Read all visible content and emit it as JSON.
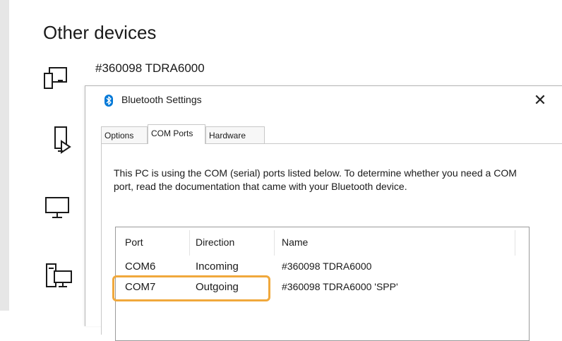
{
  "page": {
    "title": "Other devices"
  },
  "devices": [
    {
      "name": "#360098 TDRA6000",
      "icon": "phone-device-icon"
    },
    {
      "icon": "mobile-cast-device-icon"
    },
    {
      "icon": "monitor-icon"
    },
    {
      "icon": "computer-tower-icon"
    }
  ],
  "dialog": {
    "title": "Bluetooth Settings",
    "close_label": "✕",
    "tabs": [
      {
        "label": "Options",
        "active": false
      },
      {
        "label": "COM Ports",
        "active": true
      },
      {
        "label": "Hardware",
        "active": false
      }
    ],
    "description": "This PC is using the COM (serial) ports listed below. To determine whether you need a COM port, read the documentation that came with your Bluetooth device.",
    "table": {
      "headers": [
        "Port",
        "Direction",
        "Name"
      ],
      "rows": [
        {
          "port": "COM6",
          "direction": "Incoming",
          "name": "#360098 TDRA6000"
        },
        {
          "port": "COM7",
          "direction": "Outgoing",
          "name": "#360098 TDRA6000 'SPP'",
          "highlighted": true
        }
      ]
    }
  },
  "colors": {
    "highlight": "#f0a83c",
    "bluetooth": "#0078d7"
  }
}
